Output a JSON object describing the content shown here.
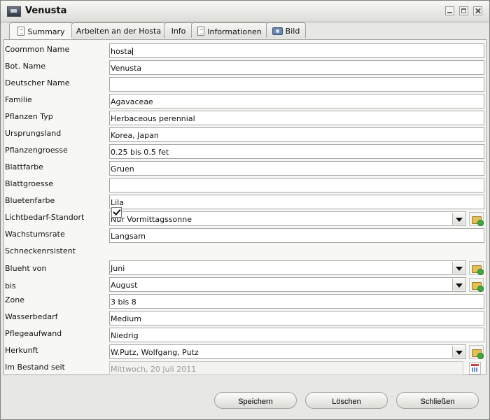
{
  "window": {
    "title": "Venusta"
  },
  "tabs": [
    {
      "label": "Summary",
      "icon": "document-icon",
      "active": true
    },
    {
      "label": "Arbeiten an der Hosta",
      "icon": null,
      "active": false
    },
    {
      "label": "Info",
      "icon": null,
      "active": false
    },
    {
      "label": "Informationen",
      "icon": "document-icon",
      "active": false
    },
    {
      "label": "Bild",
      "icon": "camera-icon",
      "active": false
    }
  ],
  "form": {
    "common_name": {
      "label": "Coommon Name",
      "value": "hosta"
    },
    "bot_name": {
      "label": "Bot. Name",
      "value": "Venusta"
    },
    "deutscher_name": {
      "label": "Deutscher Name",
      "value": ""
    },
    "familie": {
      "label": "Familie",
      "value": "Agavaceae"
    },
    "pflanzen_typ": {
      "label": "Pflanzen Typ",
      "value": "Herbaceous perennial"
    },
    "ursprungsland": {
      "label": "Ursprungsland",
      "value": "Korea, Japan"
    },
    "pflanzengroesse": {
      "label": "Pflanzengroesse",
      "value": "0.25 bis 0.5 fet"
    },
    "blattfarbe": {
      "label": "Blattfarbe",
      "value": "Gruen"
    },
    "blattgroesse": {
      "label": "Blattgroesse",
      "value": ""
    },
    "bluetenfarbe": {
      "label": "Bluetenfarbe",
      "value": "Lila"
    },
    "lichtbedarf": {
      "label": "Lichtbedarf-Standort",
      "value": "Nur Vormittagssonne"
    },
    "wachstumsrate": {
      "label": "Wachstumsrate",
      "value": "Langsam"
    },
    "schneckenresistent": {
      "label": "Schneckenrsistent",
      "checked": true
    },
    "blueht_von": {
      "label": "Blueht von",
      "value": "Juni"
    },
    "bis": {
      "label": "bis",
      "value": "August"
    },
    "zone": {
      "label": "Zone",
      "value": "3 bis 8"
    },
    "wasserbedarf": {
      "label": "Wasserbedarf",
      "value": "Medium"
    },
    "pflegeaufwand": {
      "label": "Pflegeaufwand",
      "value": "Niedrig"
    },
    "herkunft": {
      "label": "Herkunft",
      "value": "W.Putz, Wolfgang, Putz"
    },
    "im_bestand_seit": {
      "label": "Im Bestand seit",
      "value": "Mittwoch, 20 Juli 2011"
    }
  },
  "buttons": {
    "save": "Speichern",
    "delete": "Löschen",
    "close": "Schließen"
  }
}
